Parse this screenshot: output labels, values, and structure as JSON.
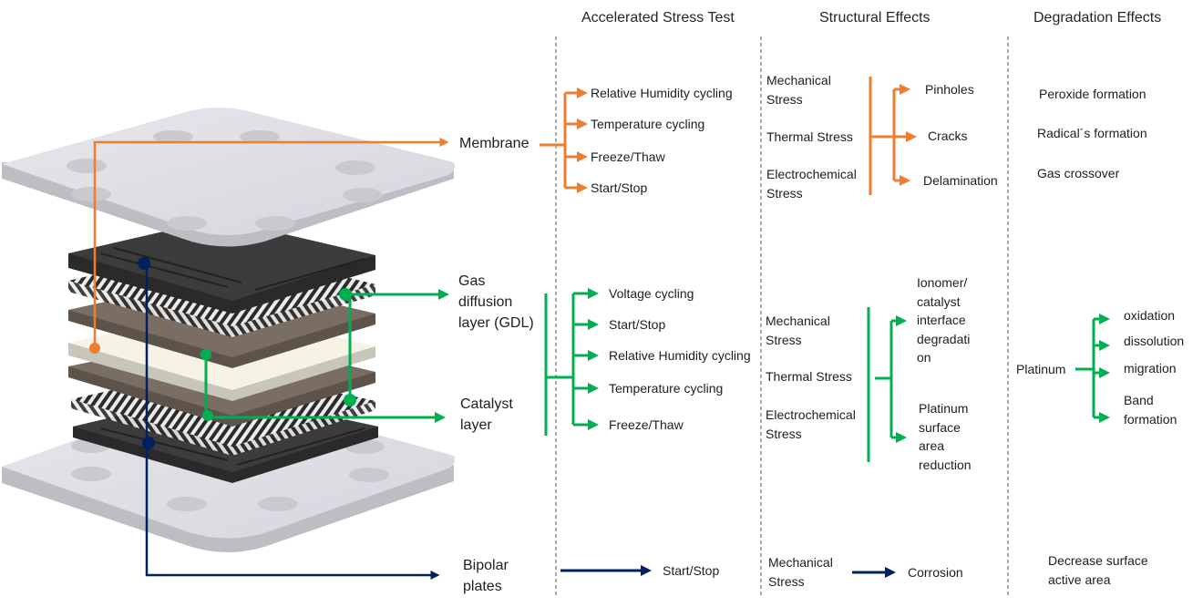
{
  "colors": {
    "membrane": "#ED7D31",
    "gdl_catalyst": "#00B050",
    "bipolar": "#002060",
    "divider": "#555555",
    "plate_light": "#E2E2E8",
    "plate_edge": "#BDBDC4",
    "flowfield": "#3C3C3C",
    "gdl_weave": "#6E6E6E",
    "catalyst": "#7A6E64",
    "membrane_layer": "#F6F3E6"
  },
  "headers": {
    "accelerated_stress_test": "Accelerated Stress Test",
    "structural_effects": "Structural Effects",
    "degradation_effects": "Degradation Effects"
  },
  "components": {
    "membrane": "Membrane",
    "gdl": [
      "Gas",
      "diffusion",
      "layer (GDL)"
    ],
    "catalyst": [
      "Catalyst",
      "layer"
    ],
    "bipolar": [
      "Bipolar",
      "plates"
    ]
  },
  "membrane": {
    "ast": [
      "Relative Humidity cycling",
      "Temperature cycling",
      "Freeze/Thaw",
      "Start/Stop"
    ],
    "stresses": [
      [
        "Mechanical",
        "Stress"
      ],
      [
        "Thermal Stress"
      ],
      [
        "Electrochemical",
        "Stress"
      ]
    ],
    "structural": [
      "Pinholes",
      "Cracks",
      "Delamination"
    ],
    "degradation": [
      "Peroxide formation",
      "Radical´s formation",
      "Gas crossover"
    ]
  },
  "gdl_catalyst": {
    "ast": [
      "Voltage cycling",
      "Start/Stop",
      "Relative Humidity cycling",
      "Temperature cycling",
      "Freeze/Thaw"
    ],
    "stresses": [
      [
        "Mechanical",
        "Stress"
      ],
      [
        "Thermal Stress"
      ],
      [
        "Electrochemical",
        "Stress"
      ]
    ],
    "structural": [
      [
        "Ionomer/",
        "catalyst",
        "interface",
        "degradati",
        "on"
      ],
      [
        "Platinum",
        "surface",
        "area",
        "reduction"
      ]
    ],
    "degradation_source": "Platinum",
    "degradation": [
      [
        "oxidation"
      ],
      [
        "dissolution"
      ],
      [
        "migration"
      ],
      [
        "Band",
        "formation"
      ]
    ]
  },
  "bipolar": {
    "ast": "Start/Stop",
    "stress": [
      "Mechanical",
      "Stress"
    ],
    "structural": "Corrosion",
    "degradation": [
      "Decrease surface",
      "active area"
    ]
  }
}
